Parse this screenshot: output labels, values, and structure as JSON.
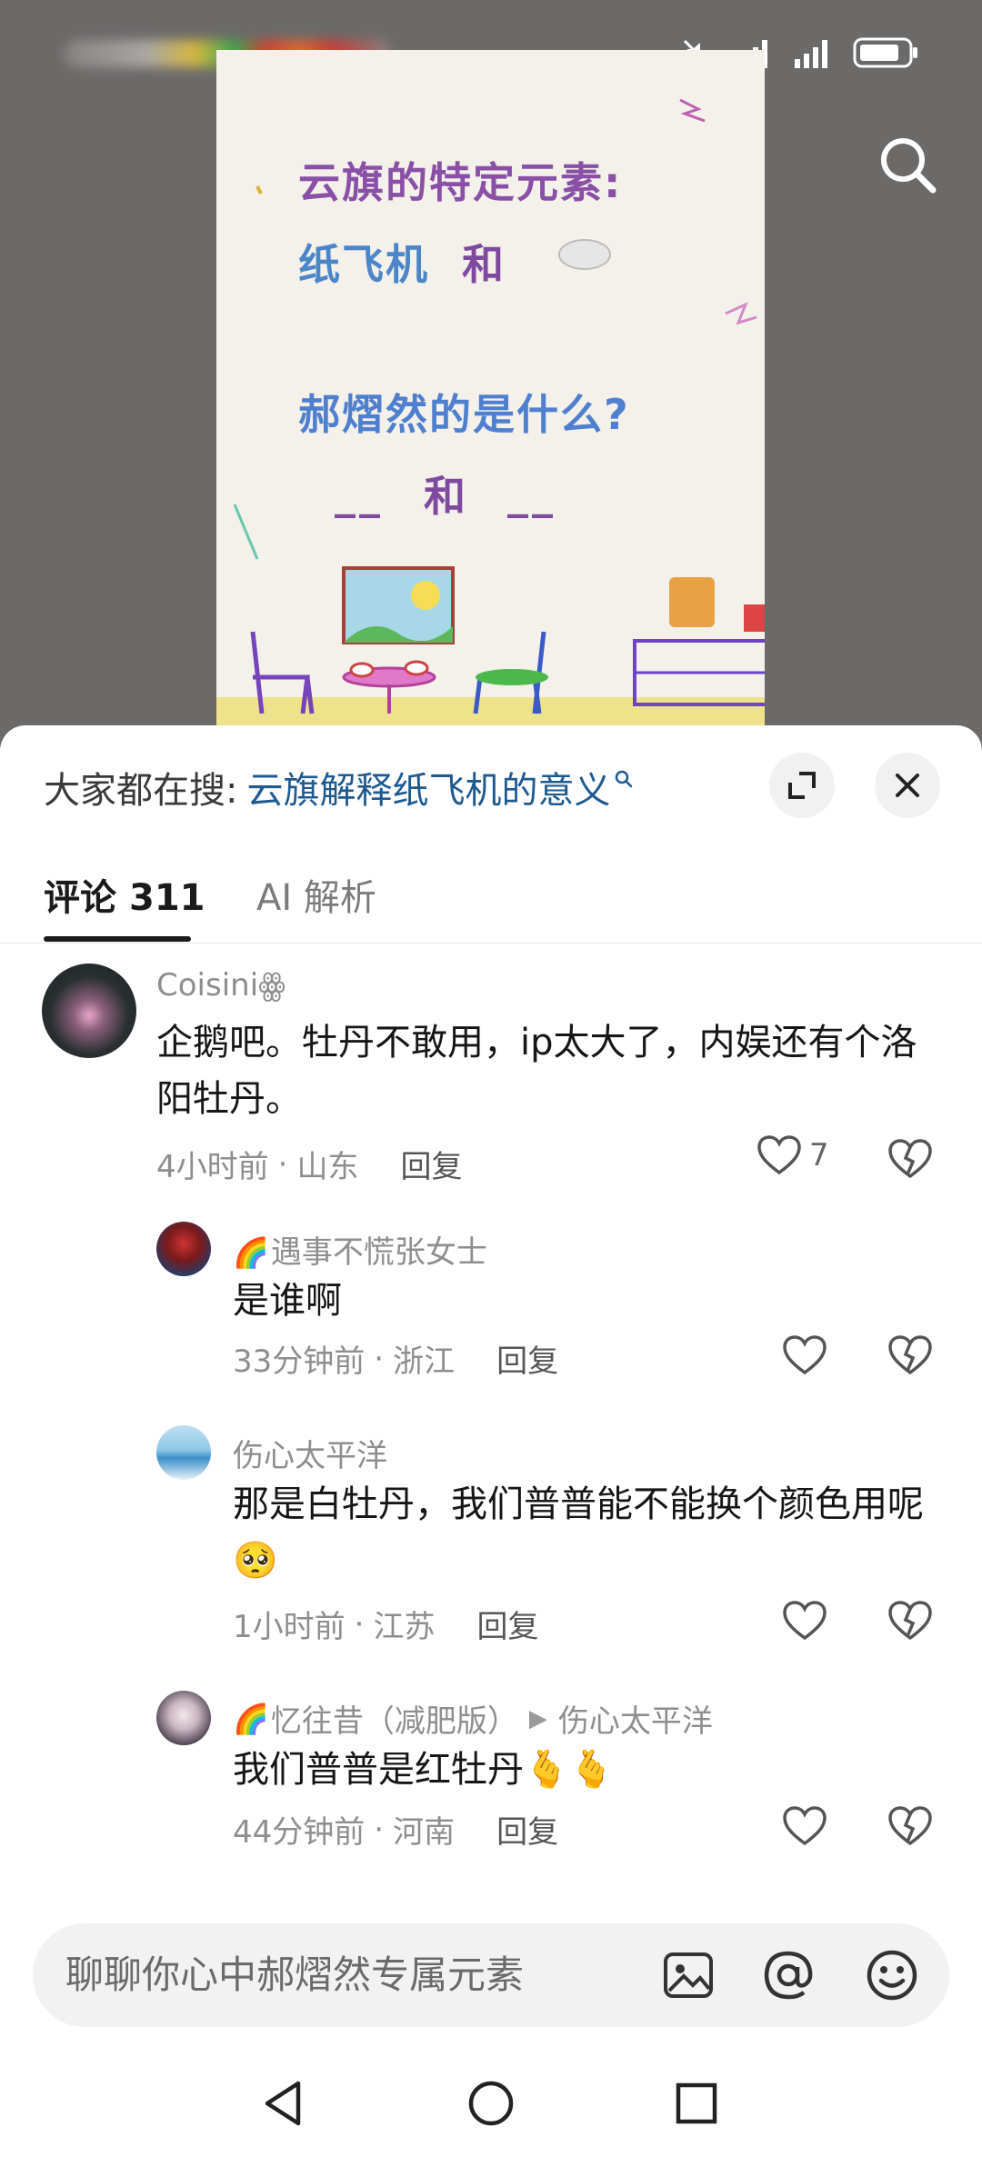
{
  "status_bar": {
    "signal_icons": [
      "mute-icon",
      "signal-icon",
      "signal-icon",
      "battery-icon"
    ]
  },
  "poster": {
    "line1": "云旗的特定元素:",
    "line2_left": "纸飞机",
    "line2_mid": "和",
    "line3": "郝熠然的是什么?",
    "line4_blank": "__",
    "line4_mid": "和"
  },
  "sheet": {
    "hot_search_label": "大家都在搜:",
    "hot_search_query": "云旗解释纸飞机的意义",
    "tabs": [
      {
        "label": "评论",
        "count": "311"
      },
      {
        "label": "AI 解析"
      }
    ]
  },
  "comments": [
    {
      "name": "Coisiniꙮ",
      "text": "企鹅吧。牡丹不敢用，ip太大了，内娱还有个洛阳牡丹。",
      "time": "4小时前",
      "location": "山东",
      "reply": "回复",
      "likes": "7"
    },
    {
      "name": "遇事不慌张女士",
      "text": "是谁啊",
      "time": "33分钟前",
      "location": "浙江",
      "reply": "回复",
      "likes": ""
    },
    {
      "name": "伤心太平洋",
      "text": "那是白牡丹，我们普普能不能换个颜色用呢🥺",
      "time": "1小时前",
      "location": "江苏",
      "reply": "回复",
      "likes": ""
    },
    {
      "name": "忆往昔（减肥版）",
      "reply_to": "伤心太平洋",
      "text": "我们普普是红牡丹🫰🫰",
      "time": "44分钟前",
      "location": "河南",
      "reply": "回复",
      "likes": ""
    }
  ],
  "input": {
    "placeholder": "聊聊你心中郝熠然专属元素"
  },
  "colors": {
    "link": "#1e5a8f",
    "muted": "#8e8e8e",
    "sheet": "#ffffff",
    "video_bg": "#6c6a69"
  }
}
